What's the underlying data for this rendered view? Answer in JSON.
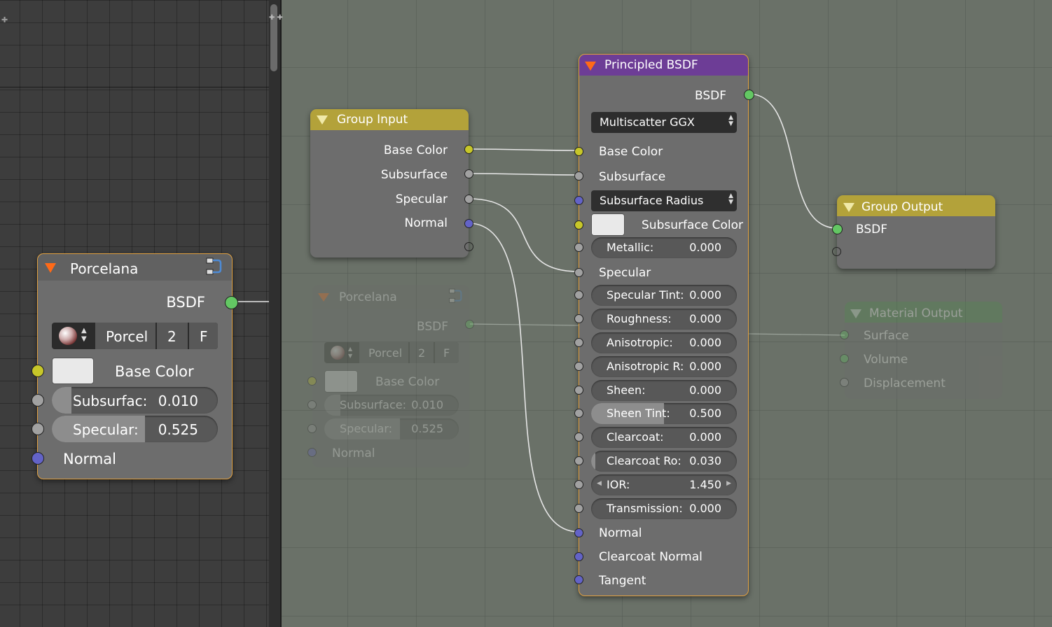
{
  "colors": {
    "group_header": "#b8a43b",
    "principled_header": "#6b3f9e",
    "output_header": "#4e8a4e",
    "socket_color": "#c7c729",
    "socket_float": "#a1a1a1",
    "socket_vector": "#6363c7",
    "socket_shader": "#63c763"
  },
  "porcelana": {
    "title": "Porcelana",
    "output": "BSDF",
    "group_name": "Porcel",
    "users": "2",
    "fake": "F",
    "base_color": "Base Color",
    "subsurface_label": "Subsurfac:",
    "subsurface_value": "0.010",
    "specular_label": "Specular:",
    "specular_value": "0.525",
    "normal": "Normal"
  },
  "ghost": {
    "title": "Porcelana",
    "output": "BSDF",
    "group_name": "Porcel",
    "users": "2",
    "fake": "F",
    "base_color": "Base Color",
    "subsurface_label": "Subsurface:",
    "subsurface_value": "0.010",
    "specular_label": "Specular:",
    "specular_value": "0.525",
    "normal": "Normal"
  },
  "group_input": {
    "title": "Group Input",
    "outputs": [
      "Base Color",
      "Subsurface",
      "Specular",
      "Normal"
    ]
  },
  "principled": {
    "title": "Principled BSDF",
    "output": "BSDF",
    "distribution": "Multiscatter GGX",
    "base_color": "Base Color",
    "subsurface": "Subsurface",
    "subsurface_method": "Subsurface Radius",
    "subsurface_color": "Subsurface Color",
    "specular": "Specular",
    "params": [
      {
        "label": "Metallic:",
        "value": "0.000",
        "fill": 0
      },
      {
        "label": "Specular Tint:",
        "value": "0.000",
        "fill": 0
      },
      {
        "label": "Roughness:",
        "value": "0.000",
        "fill": 0
      },
      {
        "label": "Anisotropic:",
        "value": "0.000",
        "fill": 0
      },
      {
        "label": "Anisotropic R:",
        "value": "0.000",
        "fill": 0
      },
      {
        "label": "Sheen:",
        "value": "0.000",
        "fill": 0
      },
      {
        "label": "Sheen Tint:",
        "value": "0.500",
        "fill": 0.5
      },
      {
        "label": "Clearcoat:",
        "value": "0.000",
        "fill": 0
      },
      {
        "label": "Clearcoat Ro:",
        "value": "0.030",
        "fill": 0.03
      },
      {
        "label": "IOR:",
        "value": "1.450",
        "fill": 0
      },
      {
        "label": "Transmission:",
        "value": "0.000",
        "fill": 0
      }
    ],
    "normal": "Normal",
    "clearcoat_normal": "Clearcoat Normal",
    "tangent": "Tangent"
  },
  "group_output": {
    "title": "Group Output",
    "input": "BSDF"
  },
  "material_output": {
    "title": "Material Output",
    "inputs": [
      "Surface",
      "Volume",
      "Displacement"
    ]
  }
}
